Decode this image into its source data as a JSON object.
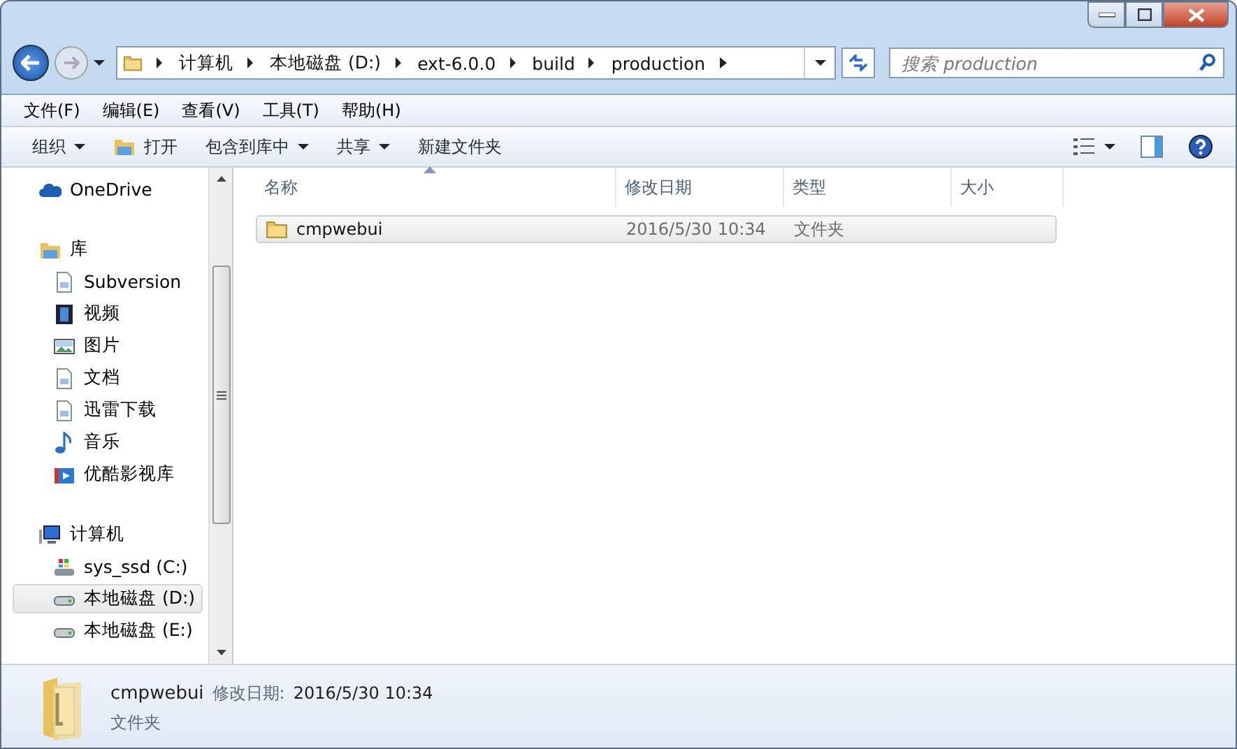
{
  "address": {
    "crumbs": [
      "计算机",
      "本地磁盘 (D:)",
      "ext-6.0.0",
      "build",
      "production"
    ]
  },
  "search": {
    "placeholder": "搜索 production"
  },
  "menu": [
    "文件(F)",
    "编辑(E)",
    "查看(V)",
    "工具(T)",
    "帮助(H)"
  ],
  "toolbar": [
    {
      "label": "组织",
      "kind": "dropdown"
    },
    {
      "label": "打开",
      "kind": "open"
    },
    {
      "label": "包含到库中",
      "kind": "dropdown"
    },
    {
      "label": "共享",
      "kind": "dropdown"
    },
    {
      "label": "新建文件夹",
      "kind": "plain"
    }
  ],
  "sidebar": {
    "items": [
      {
        "label": "OneDrive",
        "kind": "cloud",
        "selected": false
      },
      {
        "label": "库",
        "kind": "library",
        "selected": false,
        "children": [
          {
            "label": "Subversion",
            "kind": "doc",
            "selected": false
          },
          {
            "label": "视频",
            "kind": "video",
            "selected": false
          },
          {
            "label": "图片",
            "kind": "picture",
            "selected": false
          },
          {
            "label": "文档",
            "kind": "doc",
            "selected": false
          },
          {
            "label": "迅雷下载",
            "kind": "doc",
            "selected": false
          },
          {
            "label": "音乐",
            "kind": "music",
            "selected": false
          },
          {
            "label": "优酷影视库",
            "kind": "play",
            "selected": false
          }
        ]
      },
      {
        "label": "计算机",
        "kind": "computer",
        "selected": false,
        "children": [
          {
            "label": "sys_ssd (C:)",
            "kind": "sysdrive",
            "selected": false
          },
          {
            "label": "本地磁盘 (D:)",
            "kind": "drive",
            "selected": true
          },
          {
            "label": "本地磁盘 (E:)",
            "kind": "drive",
            "selected": false
          }
        ]
      }
    ]
  },
  "columns": [
    {
      "label": "名称",
      "sorted": true
    },
    {
      "label": "修改日期",
      "sorted": false
    },
    {
      "label": "类型",
      "sorted": false
    },
    {
      "label": "大小",
      "sorted": false
    }
  ],
  "files": [
    {
      "name": "cmpwebui",
      "modified": "2016/5/30 10:34",
      "type": "文件夹",
      "selected": true
    }
  ],
  "details": {
    "name": "cmpwebui",
    "modified_label": "修改日期:",
    "modified": "2016/5/30 10:34",
    "type": "文件夹"
  }
}
